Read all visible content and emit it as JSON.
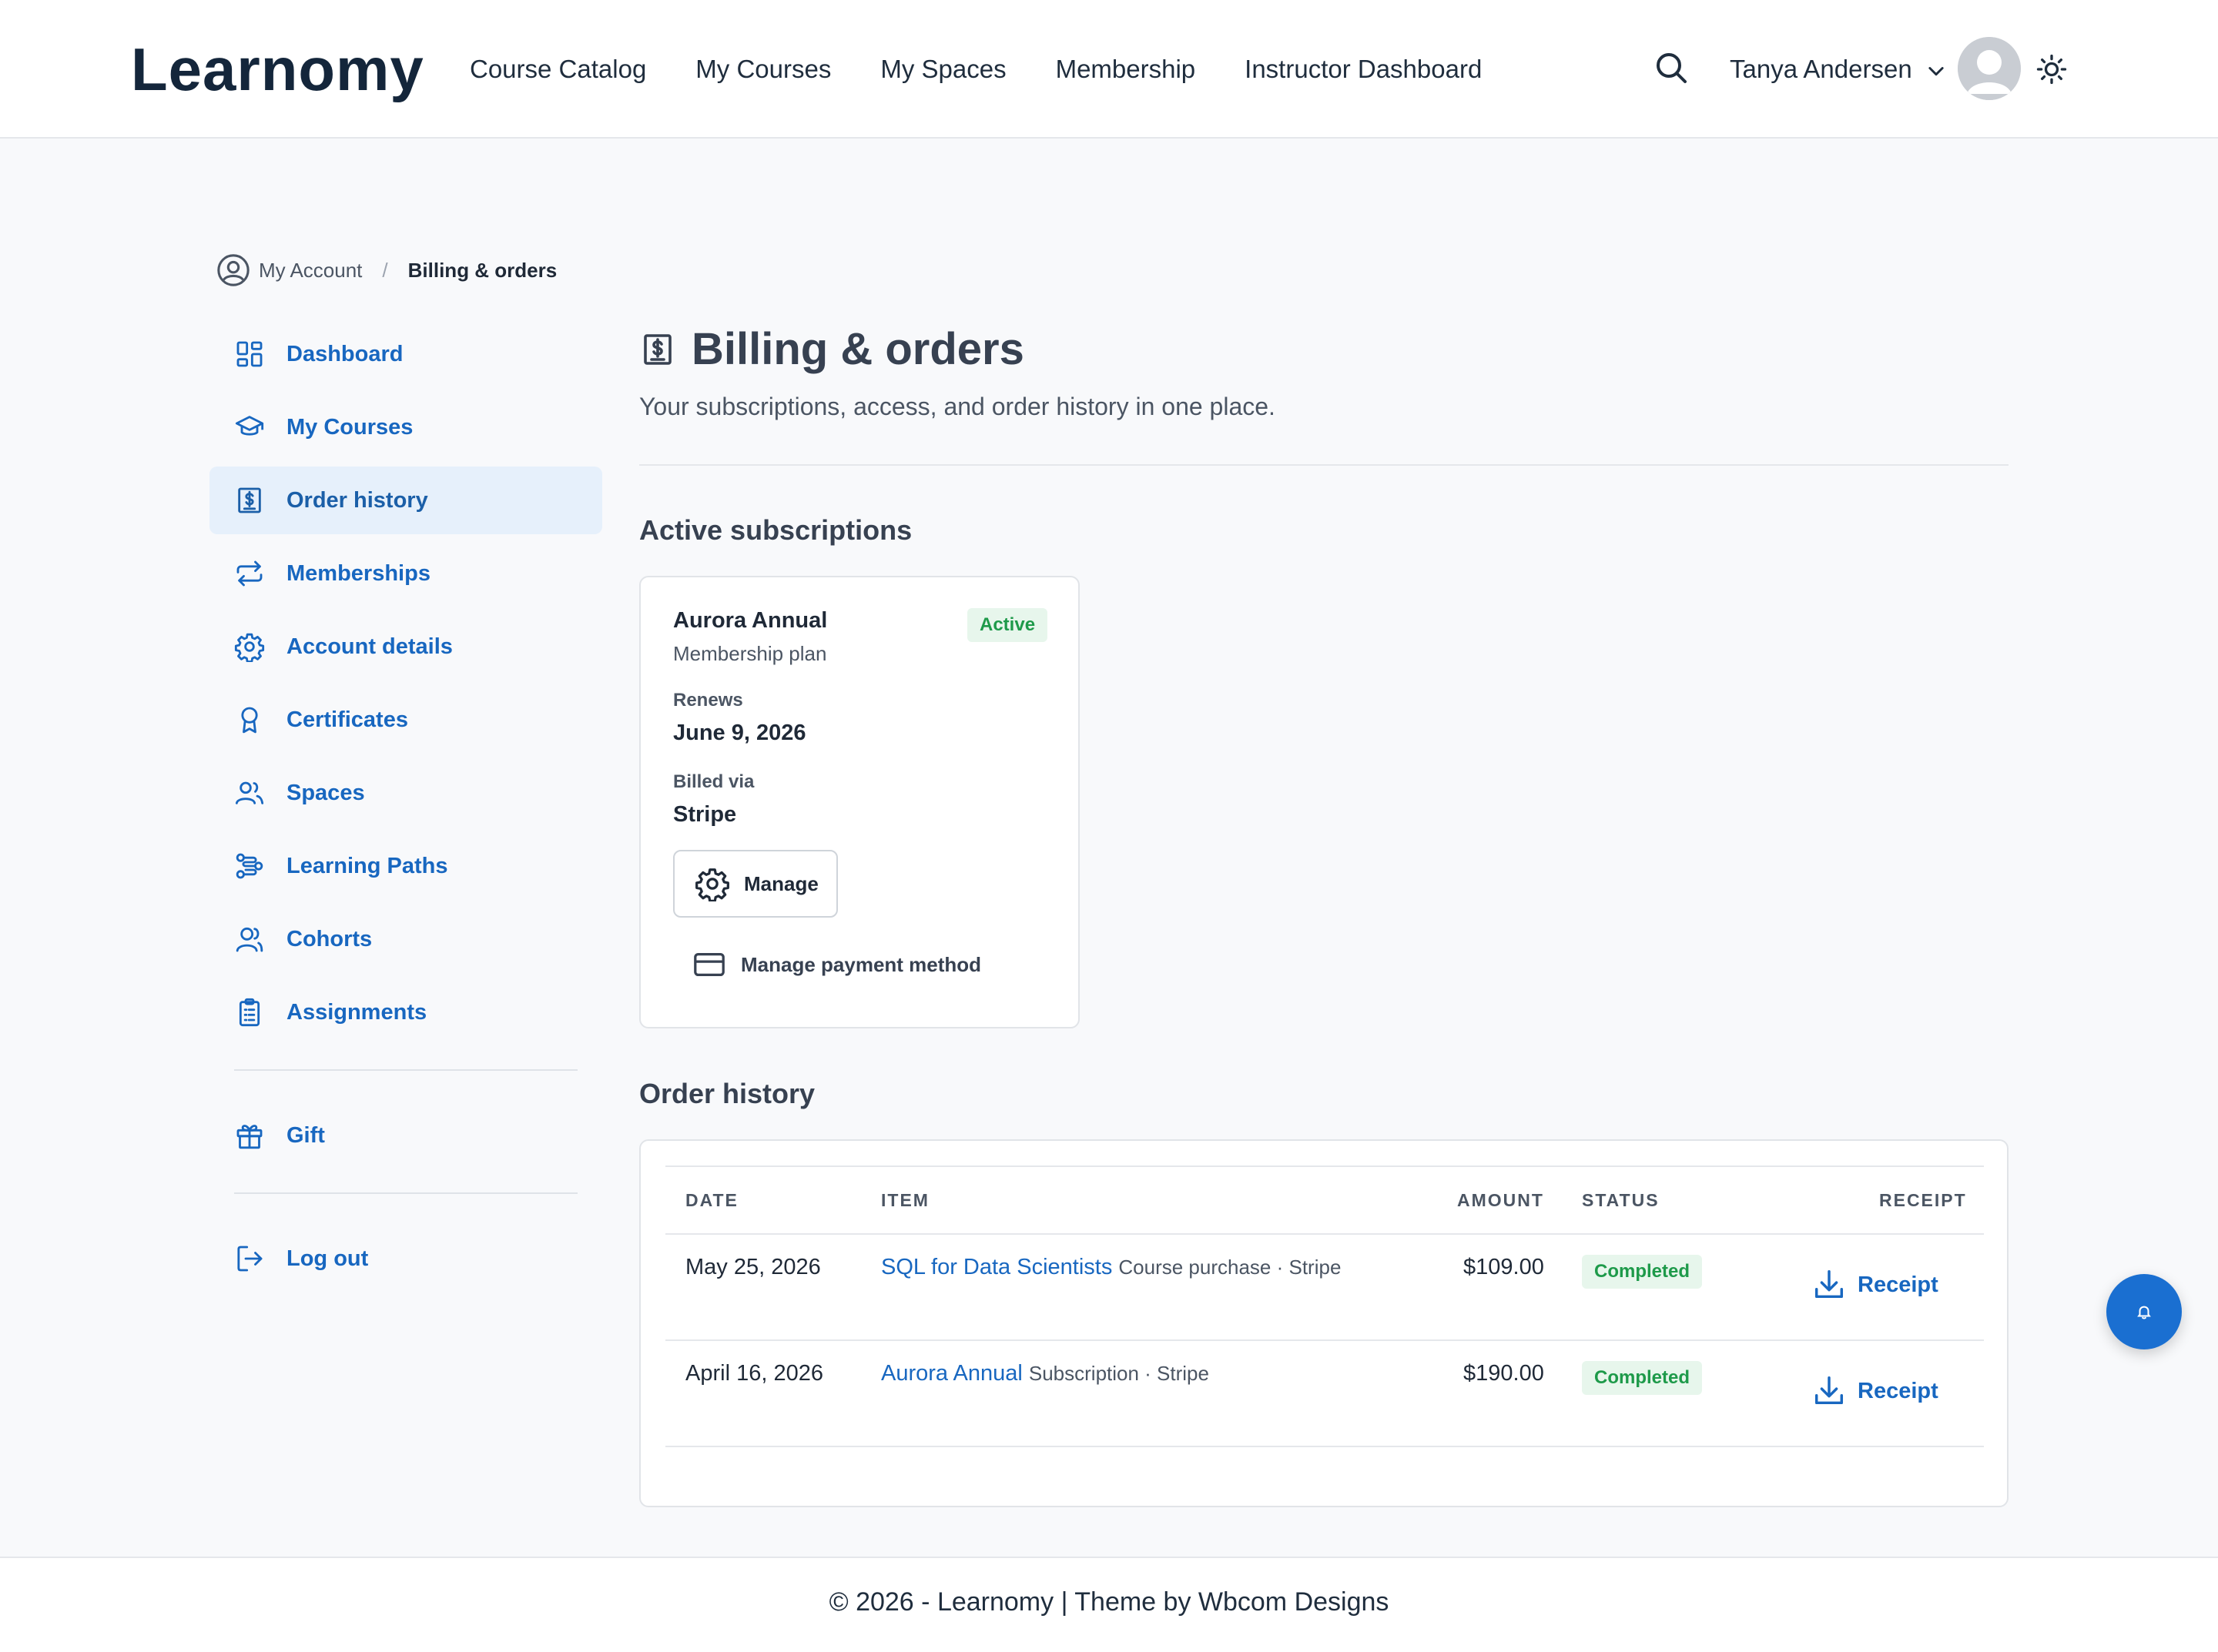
{
  "header": {
    "logo": "Learnomy",
    "nav": [
      "Course Catalog",
      "My Courses",
      "My Spaces",
      "Membership",
      "Instructor Dashboard"
    ],
    "user_name": "Tanya Andersen"
  },
  "breadcrumb": {
    "parent": "My Account",
    "separator": "/",
    "current": "Billing & orders"
  },
  "sidebar": {
    "items": [
      {
        "label": "Dashboard",
        "icon": "grid-icon"
      },
      {
        "label": "My Courses",
        "icon": "graduation-cap-icon"
      },
      {
        "label": "Order history",
        "icon": "receipt-icon",
        "active": true
      },
      {
        "label": "Memberships",
        "icon": "repeat-icon"
      },
      {
        "label": "Account details",
        "icon": "gear-icon"
      },
      {
        "label": "Certificates",
        "icon": "award-icon"
      },
      {
        "label": "Spaces",
        "icon": "users-icon"
      },
      {
        "label": "Learning Paths",
        "icon": "route-icon"
      },
      {
        "label": "Cohorts",
        "icon": "user-group-icon"
      },
      {
        "label": "Assignments",
        "icon": "clipboard-icon"
      }
    ],
    "gift": "Gift",
    "logout": "Log out"
  },
  "main": {
    "title": "Billing & orders",
    "subtitle": "Your subscriptions, access, and order history in one place.",
    "subscriptions_title": "Active subscriptions",
    "subscription": {
      "name": "Aurora Annual",
      "plan": "Membership plan",
      "status": "Active",
      "renews_label": "Renews",
      "renews_value": "June 9, 2026",
      "billed_label": "Billed via",
      "billed_value": "Stripe",
      "manage_label": "Manage",
      "payment_label": "Manage payment method"
    },
    "orders_title": "Order history",
    "orders": {
      "columns": [
        "DATE",
        "ITEM",
        "AMOUNT",
        "STATUS",
        "RECEIPT"
      ],
      "rows": [
        {
          "date": "May 25, 2026",
          "item": "SQL for Data Scientists",
          "meta": "Course purchase · Stripe",
          "amount": "$109.00",
          "status": "Completed",
          "receipt": "Receipt"
        },
        {
          "date": "April 16, 2026",
          "item": "Aurora Annual",
          "meta": "Subscription · Stripe",
          "amount": "$190.00",
          "status": "Completed",
          "receipt": "Receipt"
        }
      ]
    }
  },
  "footer": {
    "copyright": "© 2026 - ",
    "site": "Learnomy",
    "divider": " | ",
    "theme_by": "Theme by ",
    "author": "Wbcom Designs"
  },
  "colors": {
    "accent": "#1867c0",
    "active_bg": "#e6f0fb",
    "success": "#1e9a4a",
    "fab": "#1a6fd1"
  }
}
